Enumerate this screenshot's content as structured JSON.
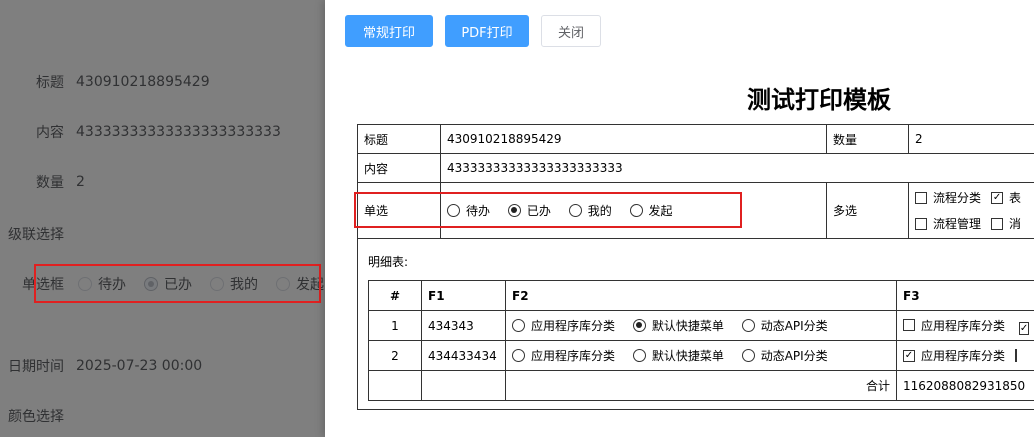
{
  "background_form": {
    "title_label": "标题",
    "title_value": "430910218895429",
    "content_label": "内容",
    "content_value": "43333333333333333333333",
    "quantity_label": "数量",
    "quantity_value": "2",
    "cascade_label": "级联选择",
    "radio_label": "单选框",
    "radio_options": [
      "待办",
      "已办",
      "我的",
      "发起"
    ],
    "radio_selected": "已办",
    "datetime_label": "日期时间",
    "datetime_value": "2025-07-23 00:00",
    "color_label": "颜色选择"
  },
  "toolbar": {
    "normal_print": "常规打印",
    "pdf_print": "PDF打印",
    "close": "关闭"
  },
  "print": {
    "title": "测试打印模板",
    "title_label": "标题",
    "title_value": "430910218895429",
    "quantity_label": "数量",
    "quantity_value": "2",
    "content_label": "内容",
    "content_value": "43333333333333333333333",
    "single_label": "单选",
    "single_options": [
      "待办",
      "已办",
      "我的",
      "发起"
    ],
    "single_selected": "已办",
    "multi_label": "多选",
    "multi_options_row1": [
      "流程分类",
      "表"
    ],
    "multi_checked_row1": [
      false,
      true
    ],
    "multi_options_row2": [
      "流程管理",
      "消"
    ],
    "multi_checked_row2": [
      false,
      false
    ],
    "detail_caption": "明细表:",
    "detail_headers": [
      "#",
      "F1",
      "F2",
      "F3"
    ],
    "detail_rows": [
      {
        "num": "1",
        "f1": "434343",
        "f2_options": [
          "应用程序库分类",
          "默认快捷菜单",
          "动态API分类"
        ],
        "f2_selected": "默认快捷菜单",
        "f3_options": [
          "应用程序库分类"
        ],
        "f3_checked": [
          false
        ]
      },
      {
        "num": "2",
        "f1": "434433434",
        "f2_options": [
          "应用程序库分类",
          "默认快捷菜单",
          "动态API分类"
        ],
        "f2_selected": "",
        "f3_options": [
          "应用程序库分类"
        ],
        "f3_checked": [
          true
        ]
      }
    ],
    "total_label": "合计",
    "total_value": "1162088082931850"
  },
  "colors": {
    "primary": "#409eff",
    "highlight": "#e02020",
    "mask": "rgba(0,0,0,0.5)"
  }
}
